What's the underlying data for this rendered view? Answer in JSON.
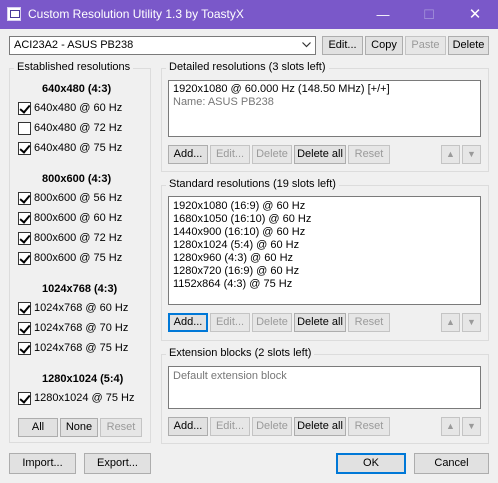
{
  "window": {
    "title": "Custom Resolution Utility 1.3 by ToastyX",
    "minimize_glyph": "—",
    "maximize_glyph": "☐",
    "close_glyph": "✕"
  },
  "monitor": {
    "selected": "ACI23A2 - ASUS PB238",
    "edit_label": "Edit...",
    "copy_label": "Copy",
    "paste_label": "Paste",
    "delete_label": "Delete"
  },
  "established": {
    "title": "Established resolutions",
    "groups": [
      {
        "heading": "640x480 (4:3)",
        "items": [
          {
            "label": "640x480 @ 60 Hz",
            "checked": true
          },
          {
            "label": "640x480 @ 72 Hz",
            "checked": false
          },
          {
            "label": "640x480 @ 75 Hz",
            "checked": true
          }
        ]
      },
      {
        "heading": "800x600 (4:3)",
        "items": [
          {
            "label": "800x600 @ 56 Hz",
            "checked": true
          },
          {
            "label": "800x600 @ 60 Hz",
            "checked": true
          },
          {
            "label": "800x600 @ 72 Hz",
            "checked": true
          },
          {
            "label": "800x600 @ 75 Hz",
            "checked": true
          }
        ]
      },
      {
        "heading": "1024x768 (4:3)",
        "items": [
          {
            "label": "1024x768 @ 60 Hz",
            "checked": true
          },
          {
            "label": "1024x768 @ 70 Hz",
            "checked": true
          },
          {
            "label": "1024x768 @ 75 Hz",
            "checked": true
          }
        ]
      },
      {
        "heading": "1280x1024 (5:4)",
        "items": [
          {
            "label": "1280x1024 @ 75 Hz",
            "checked": true
          }
        ]
      }
    ],
    "all_label": "All",
    "none_label": "None",
    "reset_label": "Reset"
  },
  "detailed": {
    "title": "Detailed resolutions (3 slots left)",
    "lines": [
      "1920x1080 @ 60.000 Hz (148.50 MHz) [+/+]",
      "Name: ASUS PB238"
    ]
  },
  "standard": {
    "title": "Standard resolutions (19 slots left)",
    "lines": [
      "1920x1080 (16:9) @ 60 Hz",
      "1680x1050 (16:10) @ 60 Hz",
      "1440x900 (16:10) @ 60 Hz",
      "1280x1024 (5:4) @ 60 Hz",
      "1280x960 (4:3) @ 60 Hz",
      "1280x720 (16:9) @ 60 Hz",
      "1152x864 (4:3) @ 75 Hz"
    ]
  },
  "extension": {
    "title": "Extension blocks (2 slots left)",
    "lines": [
      "Default extension block"
    ]
  },
  "section_buttons": {
    "add": "Add...",
    "edit": "Edit...",
    "delete": "Delete",
    "delete_all": "Delete all",
    "reset": "Reset",
    "up_glyph": "▲",
    "down_glyph": "▼"
  },
  "footer": {
    "import_label": "Import...",
    "export_label": "Export...",
    "ok_label": "OK",
    "cancel_label": "Cancel"
  },
  "colors": {
    "titlebar": "#7a58c9",
    "window_bg": "#f0f0f0",
    "focus": "#0078d7"
  },
  "icons": {
    "app": "crt-monitor-icon",
    "dropdown": "chevron-down-icon",
    "up": "arrow-up-icon",
    "down": "arrow-down-icon"
  }
}
